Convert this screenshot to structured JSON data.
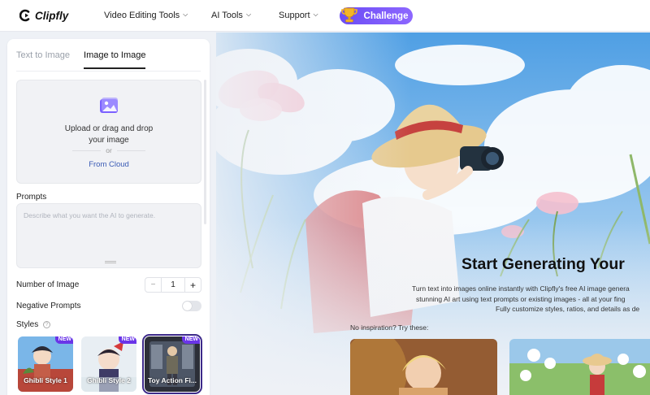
{
  "header": {
    "logo_text": "Clipfly",
    "nav": [
      {
        "label": "Video Editing Tools"
      },
      {
        "label": "AI Tools"
      },
      {
        "label": "Support"
      }
    ],
    "challenge_label": "Challenge"
  },
  "panel": {
    "tabs": [
      {
        "label": "Text to Image",
        "active": false
      },
      {
        "label": "Image to Image",
        "active": true
      }
    ],
    "upload": {
      "line1": "Upload or drag and drop",
      "line2": "your image",
      "or_text": "or",
      "cloud_label": "From Cloud"
    },
    "prompts": {
      "label": "Prompts",
      "placeholder": "Describe what you want the AI to generate.",
      "value": ""
    },
    "number_of_image": {
      "label": "Number of Image",
      "minus": "−",
      "value": "1",
      "plus": "+"
    },
    "negative_prompts": {
      "label": "Negative Prompts",
      "enabled": false
    },
    "styles": {
      "label": "Styles",
      "help_glyph": "?",
      "items": [
        {
          "name": "Ghibli Style 1",
          "badge": "NEW",
          "selected": false
        },
        {
          "name": "Ghibli Style 2",
          "badge": "NEW",
          "selected": false
        },
        {
          "name": "Toy Action Fi...",
          "badge": "NEW",
          "selected": true
        }
      ]
    }
  },
  "hero": {
    "title": "Start Generating Your",
    "desc_lines": [
      "Turn text into images online instantly with Clipfly's free AI image genera",
      "stunning AI art using text prompts or existing images - all at your fing",
      "Fully customize styles, ratios, and details as de"
    ],
    "inspiration_label": "No inspiration? Try these:"
  },
  "colors": {
    "accent": "#6b4df5",
    "link": "#3a5bb5",
    "badge": "#6a35e8"
  }
}
